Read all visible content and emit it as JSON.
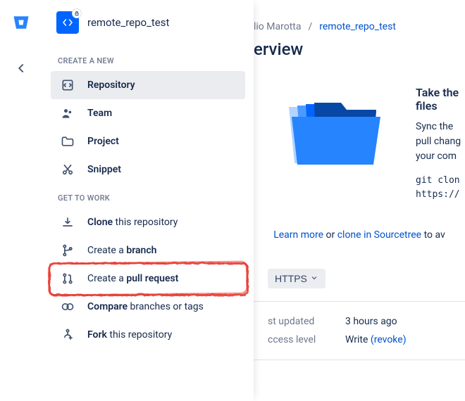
{
  "repo": {
    "name": "remote_repo_test"
  },
  "sections": {
    "create_label": "CREATE A NEW",
    "work_label": "GET TO WORK"
  },
  "create_items": [
    {
      "label": "Repository"
    },
    {
      "label": "Team"
    },
    {
      "label": "Project"
    },
    {
      "label": "Snippet"
    }
  ],
  "work_items": {
    "clone_pre": "Clone",
    "clone_post": " this repository",
    "branch_pre": "Create a ",
    "branch_post": "branch",
    "pr_pre": "Create a ",
    "pr_post": "pull request",
    "compare_pre": "Compare",
    "compare_post": " branches or tags",
    "fork_pre": "Fork",
    "fork_post": " this repository"
  },
  "breadcrumb": {
    "owner": "lio Marotta",
    "sep": "/",
    "repo": "remote_repo_test"
  },
  "page_title": "erview",
  "onboard": {
    "heading": "Take the files",
    "body": "Sync the pull chang your com",
    "code_line1": "git clon",
    "code_line2": "https://"
  },
  "learn": {
    "learn": "Learn more",
    "or": " or ",
    "sourcetree": "clone in Sourcetree",
    "tail": " to av"
  },
  "protocol": {
    "label": "HTTPS"
  },
  "meta": {
    "updated_label": "st updated",
    "updated_value": "3 hours ago",
    "access_label": "ccess level",
    "access_value": "Write ",
    "access_revoke": "(revoke)"
  }
}
